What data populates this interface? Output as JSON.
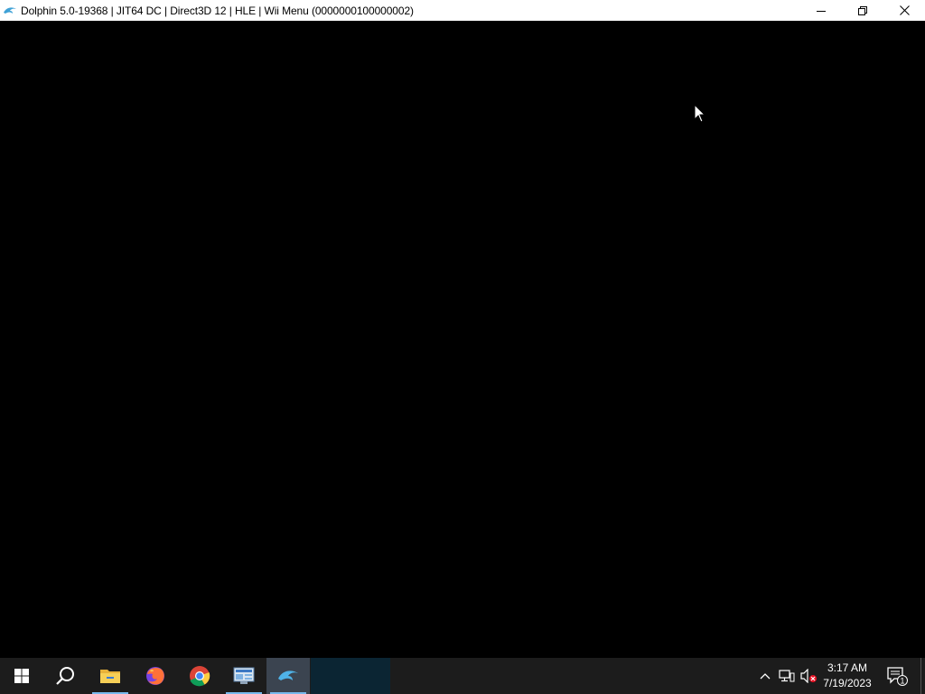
{
  "window": {
    "title": "Dolphin 5.0-19368 | JIT64 DC | Direct3D 12 | HLE | Wii Menu (0000000100000002)",
    "app_icon": "dolphin-icon",
    "controls": [
      "minimize-icon",
      "restore-icon",
      "close-icon"
    ]
  },
  "taskbar": {
    "items": [
      {
        "name": "start-button",
        "icon": "windows-logo-icon"
      },
      {
        "name": "search-button",
        "icon": "search-icon"
      },
      {
        "name": "file-explorer",
        "icon": "folder-icon",
        "running": true
      },
      {
        "name": "firefox",
        "icon": "firefox-icon"
      },
      {
        "name": "chrome",
        "icon": "chrome-icon"
      },
      {
        "name": "control-panel",
        "icon": "control-panel-icon",
        "running": true
      },
      {
        "name": "dolphin",
        "icon": "dolphin-icon",
        "running": true,
        "active": true
      }
    ],
    "tray": {
      "icons": [
        "chevron-up-icon",
        "network-icon",
        "volume-muted-icon"
      ],
      "time": "3:17 AM",
      "date": "7/19/2023",
      "notifications": "1"
    }
  },
  "colors": {
    "taskbar_bg": "#1c1c1c",
    "accent": "#76b9ed",
    "render_bg": "#000000"
  }
}
